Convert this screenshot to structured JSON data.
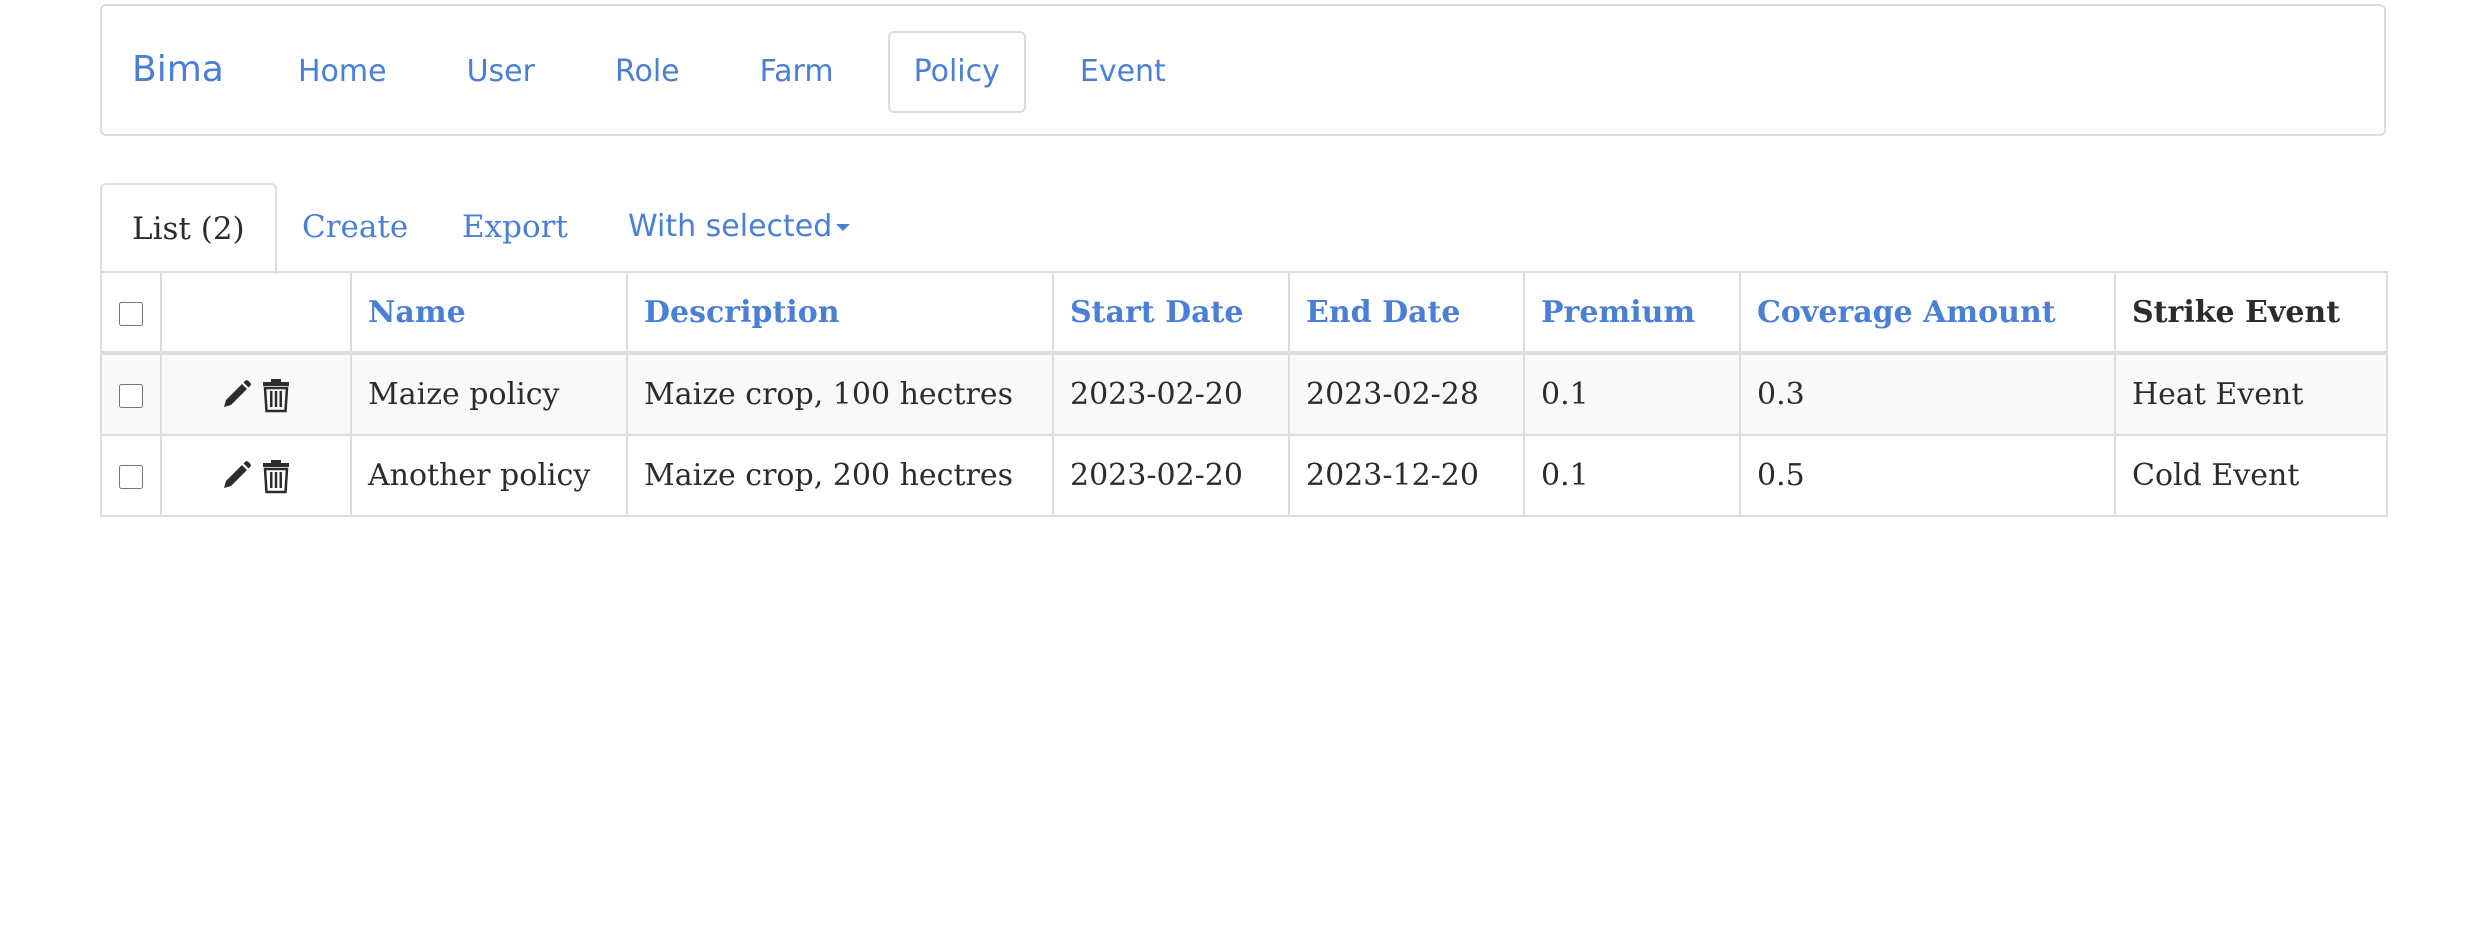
{
  "navbar": {
    "brand": "Bima",
    "links": [
      {
        "label": "Home",
        "active": false
      },
      {
        "label": "User",
        "active": false
      },
      {
        "label": "Role",
        "active": false
      },
      {
        "label": "Farm",
        "active": false
      },
      {
        "label": "Policy",
        "active": true
      },
      {
        "label": "Event",
        "active": false
      }
    ]
  },
  "tabs": {
    "list": "List (2)",
    "create": "Create",
    "export": "Export",
    "with_selected": "With selected"
  },
  "table": {
    "columns": {
      "name": "Name",
      "description": "Description",
      "start_date": "Start Date",
      "end_date": "End Date",
      "premium": "Premium",
      "coverage_amount": "Coverage Amount",
      "strike_event": "Strike Event"
    },
    "rows": [
      {
        "name": "Maize policy",
        "description": "Maize crop, 100 hectres",
        "start_date": "2023-02-20",
        "end_date": "2023-02-28",
        "premium": "0.1",
        "coverage_amount": "0.3",
        "strike_event": "Heat Event"
      },
      {
        "name": "Another policy",
        "description": "Maize crop, 200 hectres",
        "start_date": "2023-02-20",
        "end_date": "2023-12-20",
        "premium": "0.1",
        "coverage_amount": "0.5",
        "strike_event": "Cold Event"
      }
    ]
  },
  "icons": {
    "edit": "pencil-icon",
    "delete": "trash-icon",
    "dropdown": "caret-down-icon"
  },
  "colors": {
    "link": "#4a7fd8",
    "text": "#2c2c2c",
    "border": "#dddddd",
    "stripe": "#f9f9f9"
  }
}
